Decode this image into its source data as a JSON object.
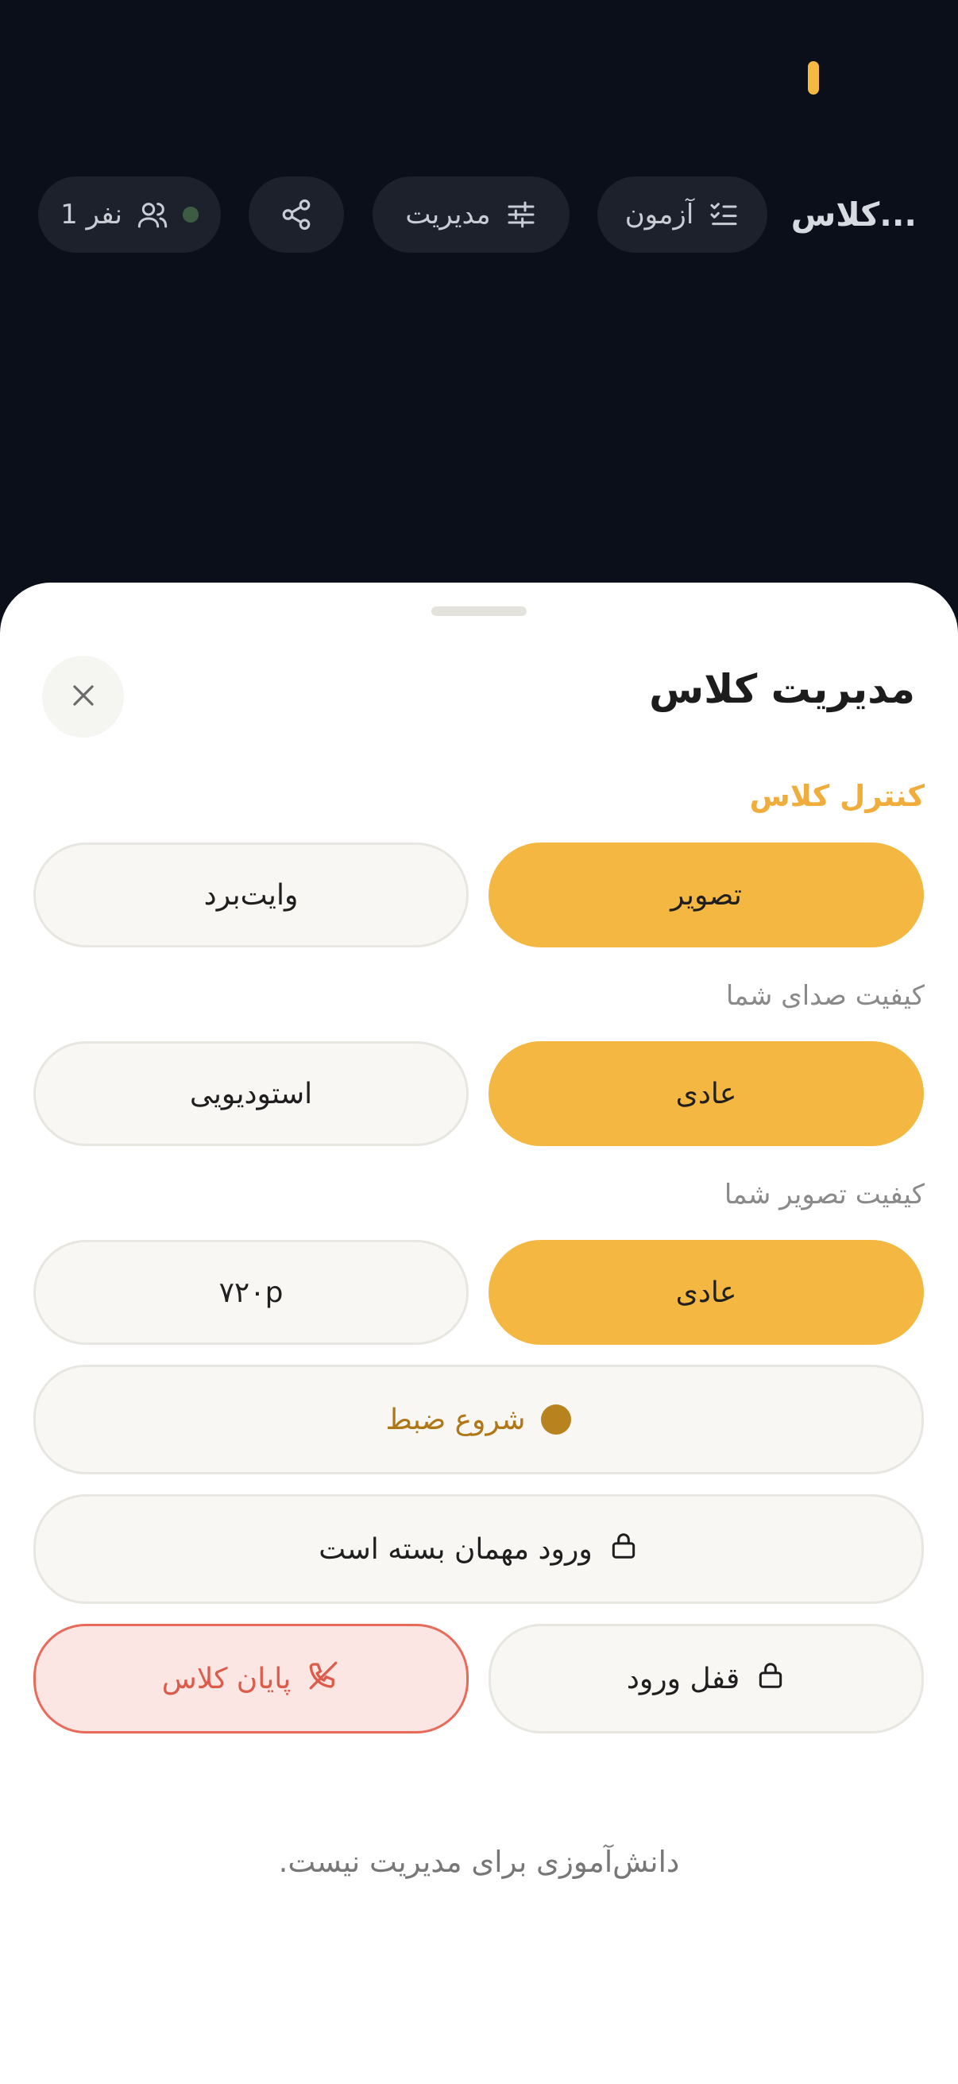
{
  "header": {
    "class_title": "کلاس...",
    "chips": {
      "quiz": "آزمون",
      "manage": "مدیریت",
      "people": "1 نفر"
    }
  },
  "sheet": {
    "title": "مدیریت کلاس",
    "class_control": {
      "label": "کنترل کلاس",
      "option_image": "تصویر",
      "option_whiteboard": "وایت‌برد",
      "selected": "تصویر"
    },
    "audio_quality": {
      "label": "کیفیت صدای شما",
      "option_normal": "عادی",
      "option_studio": "استودیویی",
      "selected": "عادی"
    },
    "video_quality": {
      "label": "کیفیت تصویر شما",
      "option_normal": "عادی",
      "option_720": "۷۲۰p",
      "selected": "عادی"
    },
    "record_button": "شروع ضبط",
    "guest_entry_button": "ورود مهمان بسته است",
    "lock_entry_button": "قفل ورود",
    "end_class_button": "پایان کلاس",
    "footer_note": "دانش‌آموزی برای مدیریت نیست."
  },
  "colors": {
    "accent": "#f4b741",
    "background_dark": "#0a0f1a",
    "danger": "#e86a5a"
  }
}
